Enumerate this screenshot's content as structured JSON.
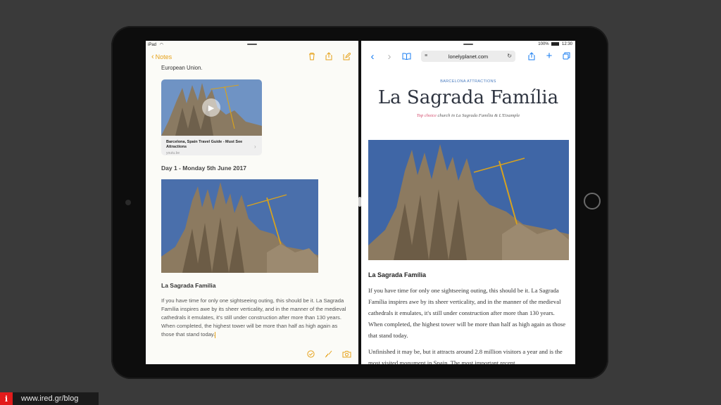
{
  "status_left": {
    "device": "iPad",
    "wifi_icon": "wifi-icon"
  },
  "status_right": {
    "battery": "100%",
    "time": "12:30"
  },
  "notes": {
    "back_label": "Notes",
    "icons": [
      "trash-icon",
      "share-icon",
      "compose-icon"
    ],
    "top_text": "European Union.",
    "link_card": {
      "title": "Barcelona, Spain Travel Guide - Must See Attractions",
      "source": "youtu.be"
    },
    "day_heading": "Day 1 - Monday 5th June 2017",
    "section_heading": "La Sagrada Familia",
    "body": "If you have time for only one sightseeing outing, this should be it. La Sagrada Família inspires awe by its sheer verticality, and in the manner of the medieval cathedrals it emulates, it's still under construction after more than 130 years. When completed, the highest tower will be more than half as high again as those that stand today.",
    "bottom_icons": [
      "checklist-icon",
      "draw-icon",
      "camera-icon"
    ]
  },
  "safari": {
    "url": "lonelyplanet.com",
    "kicker": "BARCELONA ATTRACTIONS",
    "headline": "La Sagrada Família",
    "tagline_top": "Top choice",
    "tagline_rest": " church in La Sagrada Família & L'Eixample",
    "article_heading": "La Sagrada Família",
    "paragraph1": "If you have time for only one sightseeing outing, this should be it. La Sagrada Família inspires awe by its sheer verticality, and in the manner of the medieval cathedrals it emulates, it's still under construction after more than 130 years. When completed, the highest tower will be more than half as high again as those that stand today.",
    "paragraph2": "Unfinished it may be, but it attracts around 2.8 million visitors a year and is the most visited monument in Spain. The most important recent"
  },
  "watermark": {
    "logo": "i",
    "text": "www.ired.gr/blog"
  },
  "colors": {
    "notes_accent": "#e6a21a",
    "safari_accent": "#1a7ef2",
    "tagline_accent": "#d34a6b"
  }
}
